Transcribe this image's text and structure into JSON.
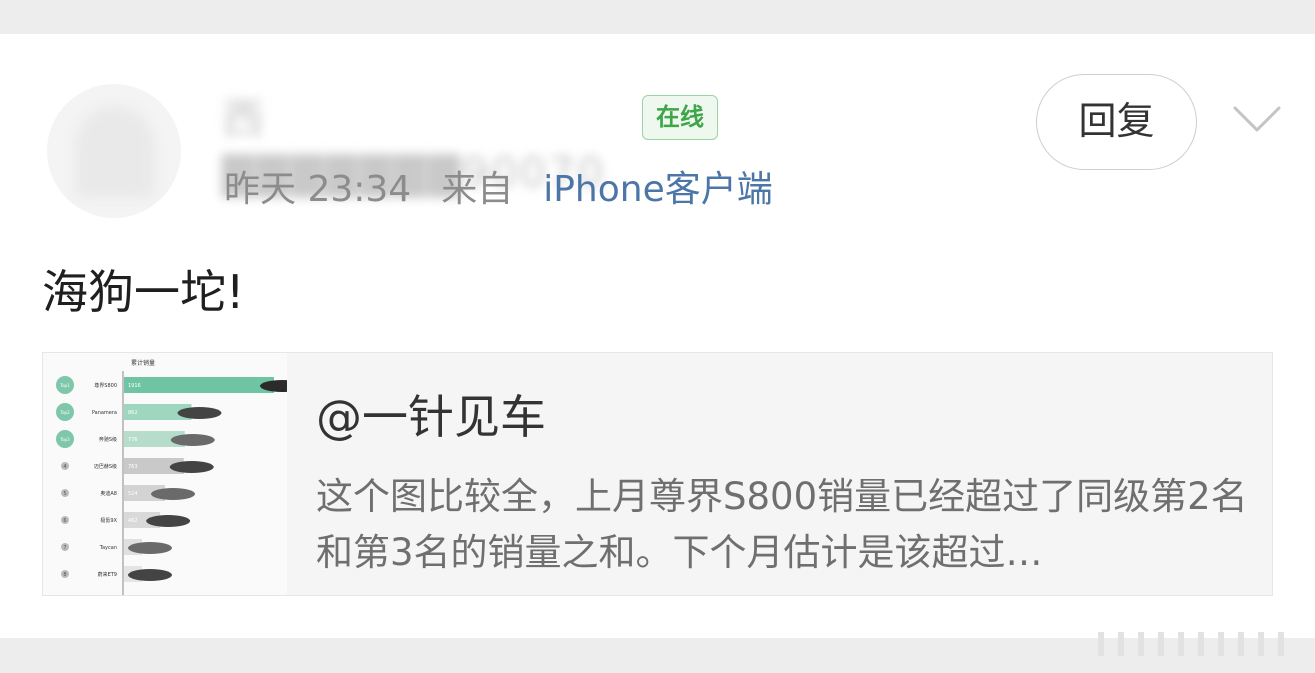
{
  "post": {
    "username": "西▇▇▇▇▇▇▇90070",
    "online_badge": "在线",
    "time": "昨天 23:34",
    "from_prefix": "来自",
    "source": "iPhone客户端",
    "reply_label": "回复",
    "text": "海狗一坨!"
  },
  "card": {
    "title": "@一针见车",
    "description": "这个图比较全，上月尊界S800销量已经超过了同级第2名和第3名的销量之和。下个月估计是该超过…",
    "thumbnail": {
      "header": "累计销量",
      "rows": [
        {
          "rank": "Top1",
          "name": "尊界S800",
          "value": "1916"
        },
        {
          "rank": "Top2",
          "name": "Panamera",
          "value": "862"
        },
        {
          "rank": "Top3",
          "name": "奔驰S级",
          "value": "776"
        },
        {
          "rank": "4",
          "name": "迈巴赫S级",
          "value": "763"
        },
        {
          "rank": "5",
          "name": "奥迪A8",
          "value": "524"
        },
        {
          "rank": "6",
          "name": "极氪9X",
          "value": "462"
        },
        {
          "rank": "7",
          "name": "Taycan",
          "value": "113"
        },
        {
          "rank": "8",
          "name": "蔚来ET9",
          "value": "105"
        }
      ],
      "values": [
        1916,
        862,
        776,
        763,
        524,
        462,
        113,
        105
      ],
      "bar_colors": [
        "#6fc4a3",
        "#9fd6c0",
        "#b6ddcc",
        "#c9c9c9",
        "#d3d3d3",
        "#d9d9d9",
        "#e0e0e0",
        "#e4e4e4"
      ]
    }
  },
  "colors": {
    "accent_link": "#4c75a8",
    "online_green": "#3ea548",
    "meta_gray": "#8c8c8c"
  },
  "icons": {
    "more": "chevron-down-icon",
    "avatar": "avatar-placeholder",
    "watermark": "watermark-lines-icon"
  }
}
